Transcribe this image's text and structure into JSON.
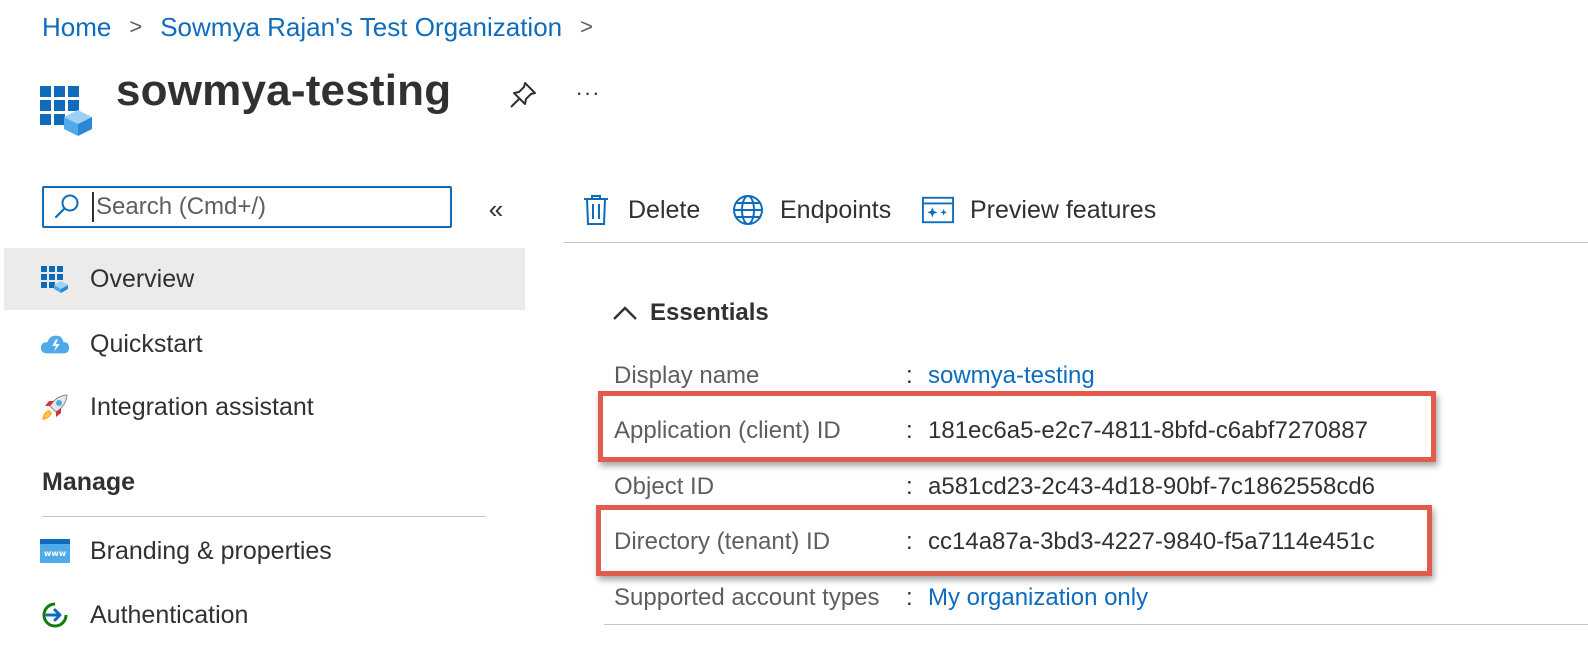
{
  "breadcrumb": {
    "items": [
      "Home",
      "Sowmya Rajan's Test Organization"
    ],
    "separator": ">"
  },
  "header": {
    "title": "sowmya-testing",
    "more_label": "···"
  },
  "search": {
    "placeholder": "Search (Cmd+/)",
    "value": ""
  },
  "sidebar": {
    "collapse_label": "«",
    "items": [
      {
        "label": "Overview",
        "icon": "app-grid-icon",
        "active": true
      },
      {
        "label": "Quickstart",
        "icon": "cloud-icon"
      },
      {
        "label": "Integration assistant",
        "icon": "rocket-icon"
      }
    ],
    "section_title": "Manage",
    "manage_items": [
      {
        "label": "Branding & properties",
        "icon": "www-icon"
      },
      {
        "label": "Authentication",
        "icon": "auth-icon"
      }
    ]
  },
  "toolbar": {
    "delete_label": "Delete",
    "endpoints_label": "Endpoints",
    "preview_label": "Preview features"
  },
  "essentials": {
    "title": "Essentials",
    "separator": ":",
    "rows": [
      {
        "key": "Display name",
        "value": "sowmya-testing",
        "link": true
      },
      {
        "key": "Application (client) ID",
        "value": "181ec6a5-e2c7-4811-8bfd-c6abf7270887",
        "link": false
      },
      {
        "key": "Object ID",
        "value": "a581cd23-2c43-4d18-90bf-7c1862558cd6",
        "link": false
      },
      {
        "key": "Directory (tenant) ID",
        "value": "cc14a87a-3bd3-4227-9840-f5a7114e451c",
        "link": false
      },
      {
        "key": "Supported account types",
        "value": "My organization only",
        "link": true
      }
    ]
  },
  "colors": {
    "accent": "#0f6cbd",
    "highlight": "#e25c4e",
    "active_nav": "#edebe9"
  }
}
